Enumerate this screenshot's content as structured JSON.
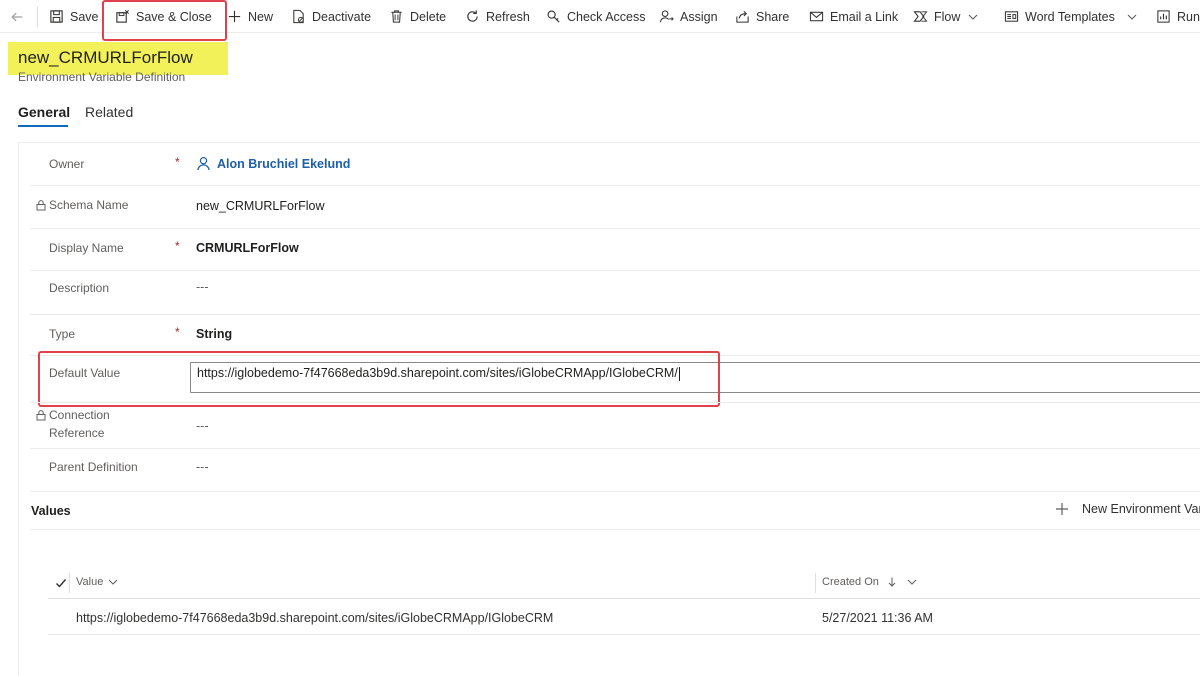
{
  "command_bar": {
    "save": "Save",
    "save_close": "Save & Close",
    "new": "New",
    "deactivate": "Deactivate",
    "delete": "Delete",
    "refresh": "Refresh",
    "check_access": "Check Access",
    "assign": "Assign",
    "share": "Share",
    "email_link": "Email a Link",
    "flow": "Flow",
    "word_templates": "Word Templates",
    "run": "Run"
  },
  "header": {
    "title": "new_CRMURLForFlow",
    "entity": "Environment Variable Definition"
  },
  "tabs": [
    {
      "label": "General",
      "active": true
    },
    {
      "label": "Related",
      "active": false
    }
  ],
  "form": {
    "owner": {
      "label": "Owner",
      "value": "Alon Bruchiel Ekelund",
      "required": "*"
    },
    "schema_name": {
      "label": "Schema Name",
      "value": "new_CRMURLForFlow"
    },
    "display_name": {
      "label": "Display Name",
      "value": "CRMURLForFlow",
      "required": "*"
    },
    "description": {
      "label": "Description",
      "value": "---"
    },
    "type": {
      "label": "Type",
      "value": "String",
      "required": "*"
    },
    "default_value": {
      "label": "Default Value",
      "value": "https://iglobedemo-7f47668eda3b9d.sharepoint.com/sites/iGlobeCRMApp/IGlobeCRM/"
    },
    "connection_reference": {
      "label_line1": "Connection",
      "label_line2": "Reference",
      "value": "---"
    },
    "parent_definition": {
      "label": "Parent Definition",
      "value": "---"
    }
  },
  "values_section": {
    "title": "Values",
    "new_button": "New Environment Vari",
    "columns": {
      "value": "Value",
      "created_on": "Created On"
    },
    "rows": [
      {
        "value": "https://iglobedemo-7f47668eda3b9d.sharepoint.com/sites/iGlobeCRMApp/IGlobeCRM",
        "created_on": "5/27/2021 11:36 AM"
      }
    ]
  },
  "colors": {
    "highlight_red": "#e0414b",
    "highlight_yellow": "#f3f15a",
    "link_blue": "#1d5fa8",
    "required_red": "#a4262c",
    "tab_underline": "#0f6cbd"
  }
}
